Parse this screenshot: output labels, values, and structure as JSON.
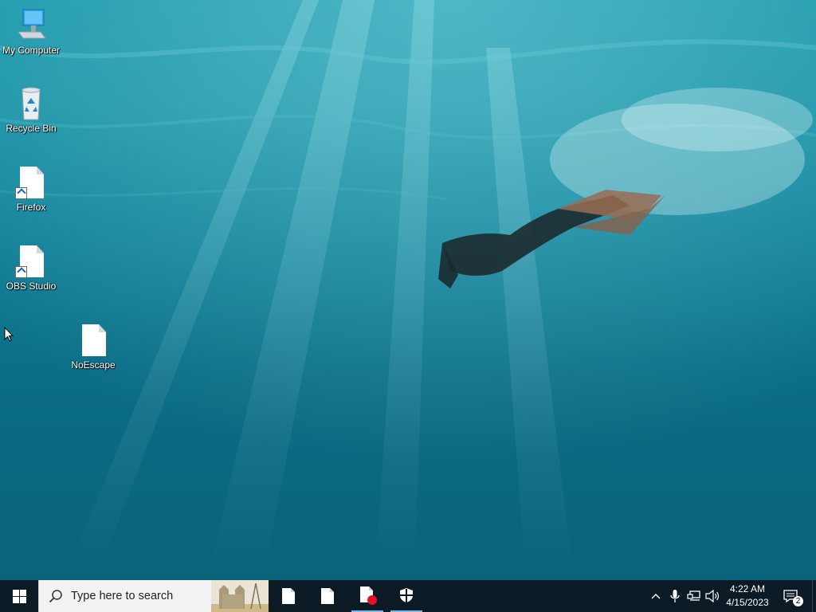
{
  "desktop": {
    "icons": [
      {
        "label": "My Computer",
        "icon": "computer-icon"
      },
      {
        "label": "Recycle Bin",
        "icon": "recycle-bin-icon"
      },
      {
        "label": "Firefox",
        "icon": "file-shortcut-icon"
      },
      {
        "label": "OBS Studio",
        "icon": "file-shortcut-icon"
      },
      {
        "label": "NoEscape",
        "icon": "file-icon"
      }
    ]
  },
  "taskbar": {
    "search_placeholder": "Type here to search",
    "apps": [
      {
        "icon": "file-icon",
        "active": false
      },
      {
        "icon": "file-icon",
        "active": false
      },
      {
        "icon": "file-record-icon",
        "active": true
      },
      {
        "icon": "shield-icon",
        "active": true
      }
    ],
    "tray": {
      "time": "4:22 AM",
      "date": "4/15/2023",
      "notifications_count": "2"
    }
  },
  "colors": {
    "taskbar_bg": "#0c1a26",
    "active_indicator": "#76b9ed",
    "record_dot": "#e81123"
  }
}
